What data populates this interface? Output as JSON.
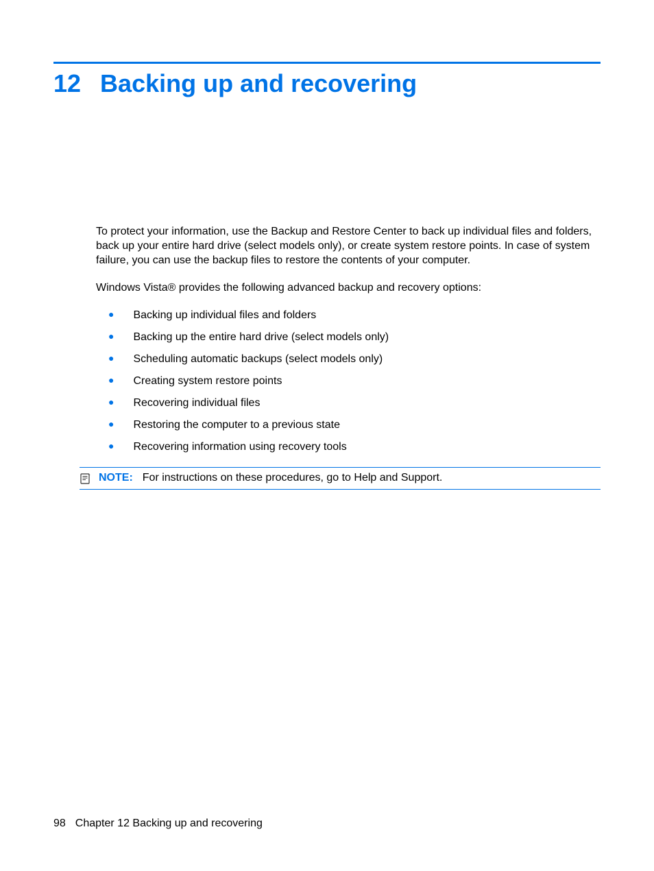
{
  "chapter": {
    "number": "12",
    "title": "Backing up and recovering"
  },
  "paragraphs": {
    "p1": "To protect your information, use the Backup and Restore Center to back up individual files and folders, back up your entire hard drive (select models only), or create system restore points. In case of system failure, you can use the backup files to restore the contents of your computer.",
    "p2": "Windows Vista® provides the following advanced backup and recovery options:"
  },
  "bullets": [
    "Backing up individual files and folders",
    "Backing up the entire hard drive (select models only)",
    "Scheduling automatic backups (select models only)",
    "Creating system restore points",
    "Recovering individual files",
    "Restoring the computer to a previous state",
    "Recovering information using recovery tools"
  ],
  "note": {
    "label": "NOTE:",
    "text": "For instructions on these procedures, go to Help and Support."
  },
  "footer": {
    "page_number": "98",
    "chapter_ref": "Chapter 12   Backing up and recovering"
  }
}
